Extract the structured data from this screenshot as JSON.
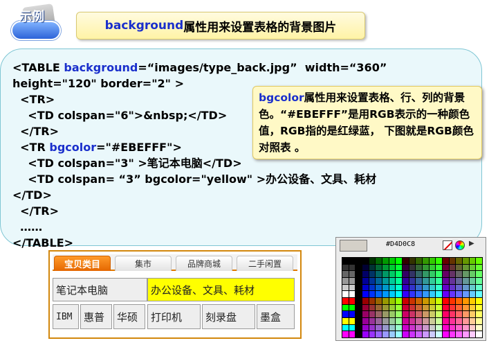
{
  "badge": {
    "label": "示例",
    "icon": "pencil-icon"
  },
  "title": {
    "keyword": "background",
    "rest": "属性用来设置表格的背景图片"
  },
  "code": {
    "line1": [
      "<TABLE ",
      "background",
      "=“images/type_back.jpg”  width=“360”"
    ],
    "line2": "height=\"120\" border=\"2\" >",
    "line3": "  <TR>",
    "line4": "    <TD colspan=\"6\">&nbsp;</TD>",
    "line5": "  </TR>",
    "line6": [
      "  <TR ",
      "bgcolor",
      "=\"#EBEFFF\">"
    ],
    "line7": "    <TD colspan=\"3\" >笔记本电脑</TD>",
    "line8": "    <TD colspan= “3” bgcolor=\"yellow\" >办公设备、文具、耗材",
    "line9": "</TD>",
    "line10": "  </TR>",
    "line11": "  ……",
    "line12": "</TABLE>"
  },
  "note": {
    "keyword": "bgcolor",
    "text": "属性用来设置表格、行、列的背景色。“#EBEFFF”是用RGB表示的一种颜色值，RGB指的是红绿蓝， 下图就是RGB颜色对照表 。"
  },
  "demo": {
    "tabs": [
      "宝贝类目",
      "集市",
      "品牌商城",
      "二手闲置"
    ],
    "row1": [
      "笔记本电脑",
      "办公设备、文具、耗材"
    ],
    "row2": [
      "IBM",
      "惠普",
      "华硕",
      "打印机",
      "刻录盘",
      "墨盒"
    ],
    "colors": {
      "accent": "#E56700",
      "yellow": "#FFFF00",
      "cell": "#EEEEEE"
    }
  },
  "picker": {
    "hex": "#D4D0C8",
    "swatch_color": "#D4D0C8",
    "icons": [
      "no-color-icon",
      "color-wheel-icon",
      "menu-arrow-icon"
    ]
  }
}
